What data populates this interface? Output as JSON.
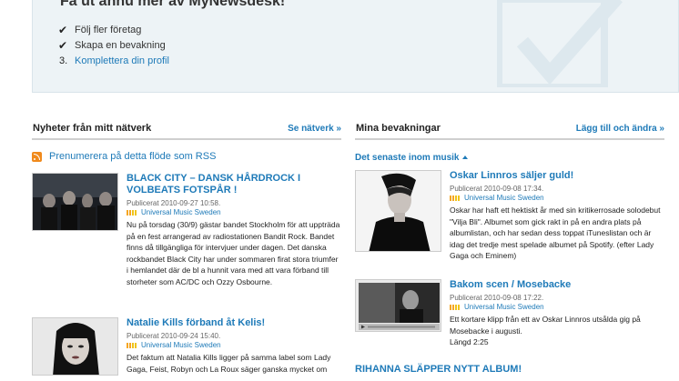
{
  "promo": {
    "title": "Få ut ännu mer av MyNewsdesk!",
    "steps": [
      {
        "marker": "✔",
        "label": "Följ fler företag",
        "done": true
      },
      {
        "marker": "✔",
        "label": "Skapa en bevakning",
        "done": true
      },
      {
        "marker": "3.",
        "label": "Komplettera din profil",
        "done": false
      }
    ]
  },
  "left": {
    "title": "Nyheter från mitt nätverk",
    "more_link": "Se nätverk »",
    "rss_label": "Prenumerera på detta flöde som RSS",
    "items": [
      {
        "title": "BLACK CITY – DANSK HÅRDROCK I VOLBEATS FOTSPÅR !",
        "published": "Publicerat 2010-09-27 10:58.",
        "source": "Universal Music Sweden",
        "description": "Nu på torsdag (30/9) gästar bandet Stockholm för att uppträda på en fest arrangerad av radiostationen Bandit Rock. Bandet finns då tillgängliga för intervjuer under dagen. Det danska rockbandet Black City har under sommaren firat stora triumfer i hemlandet där de bl a hunnit vara med att vara förband till storheter som AC/DC och Ozzy Osbourne."
      },
      {
        "title": "Natalie Kills förband åt Kelis!",
        "published": "Publicerat 2010-09-24 15:40.",
        "source": "Universal Music Sweden",
        "description": "Det faktum att Natalia Kills ligger på samma label som Lady Gaga, Feist, Robyn och La Roux säger ganska mycket om"
      }
    ]
  },
  "right": {
    "title": "Mina bevakningar",
    "more_link": "Lägg till och ändra »",
    "section_label": "Det senaste inom musik",
    "items": [
      {
        "title": "Oskar Linnros säljer guld!",
        "published": "Publicerat 2010-09-08 17:34.",
        "source": "Universal Music Sweden",
        "description": "Oskar har haft ett hektiskt år med sin kritikerrosade solodebut \"Vilja Bli\". Albumet som gick rakt in på en andra plats på albumlistan, och har sedan dess toppat iTuneslistan och är idag det tredje mest spelade albumet på Spotify. (efter Lady Gaga och Eminem)"
      },
      {
        "title": "Bakom scen / Mosebacke",
        "published": "Publicerat 2010-09-08 17:22.",
        "source": "Universal Music Sweden",
        "description": "Ett kortare klipp från ett av Oskar Linnros utsålda gig på Mosebacke i augusti.",
        "length_label": "Längd",
        "length_value": "2:25"
      }
    ],
    "next_title": "RIHANNA SLÄPPER NYTT ALBUM!"
  },
  "colors": {
    "accent": "#1e7ab8",
    "promo_bg": "#edf3f6",
    "rss": "#f08a1c",
    "source_bars": [
      "#f5a623",
      "#f5a623",
      "#f0c419",
      "#f0c419"
    ]
  }
}
